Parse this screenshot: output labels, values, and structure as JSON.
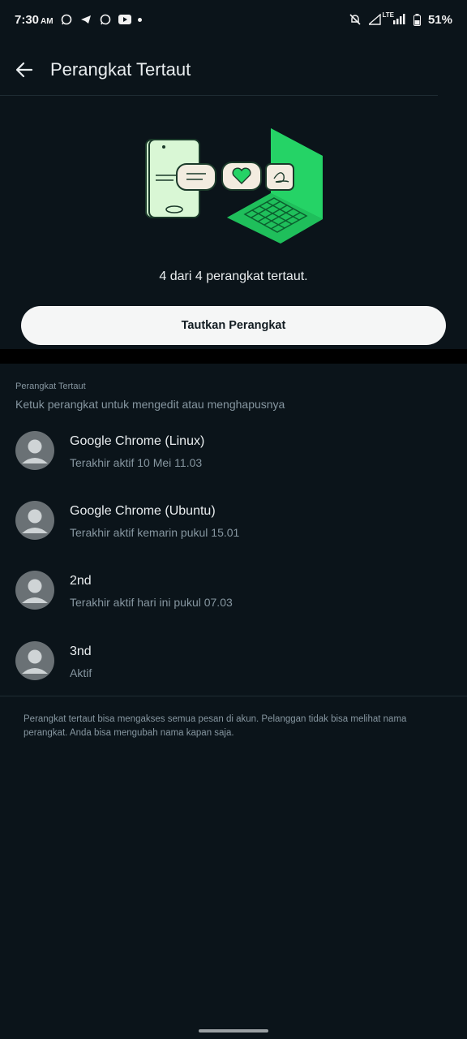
{
  "status_bar": {
    "time": "7:30",
    "ampm": "AM",
    "notification_icons": [
      "whatsapp-icon",
      "telegram-icon",
      "whatsapp-icon",
      "youtube-icon"
    ],
    "network_label": "LTE",
    "battery": "51%"
  },
  "appbar": {
    "title": "Perangkat Tertaut"
  },
  "hero": {
    "info_text": "4 dari 4 perangkat tertaut.",
    "button_label": "Tautkan Perangkat"
  },
  "section": {
    "heading": "Perangkat Tertaut",
    "subheading": "Ketuk perangkat untuk mengedit atau menghapusnya"
  },
  "devices": [
    {
      "name": "Google Chrome (Linux)",
      "status": "Terakhir aktif 10 Mei 11.03"
    },
    {
      "name": "Google Chrome (Ubuntu)",
      "status": "Terakhir aktif kemarin pukul 15.01"
    },
    {
      "name": "2nd",
      "status": "Terakhir aktif hari ini pukul 07.03"
    },
    {
      "name": "3nd",
      "status": "Aktif"
    }
  ],
  "footer_note": "Perangkat tertaut bisa mengakses semua pesan di akun. Pelanggan tidak bisa melihat nama perangkat. Anda bisa mengubah nama kapan saja.",
  "colors": {
    "background": "#0b141a",
    "accent_green": "#25d366",
    "button_bg": "#f5f6f6"
  }
}
